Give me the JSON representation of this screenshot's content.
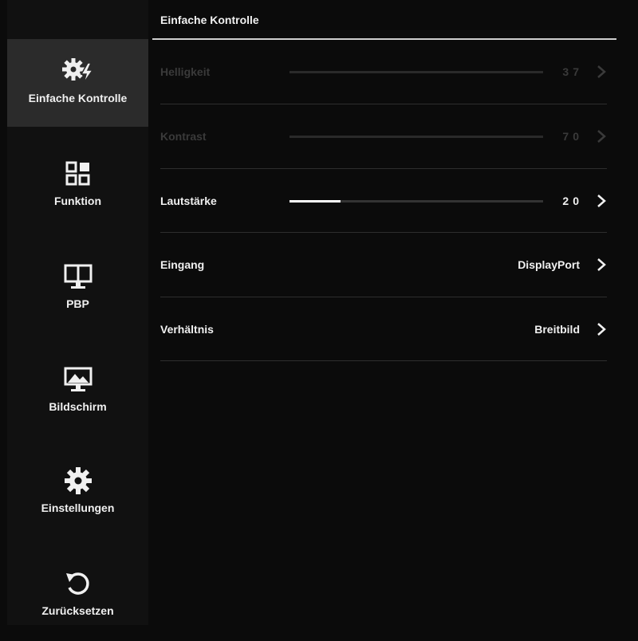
{
  "sidebar": {
    "items": [
      {
        "label": "Einfache Kontrolle",
        "icon": "gear-lightning-icon",
        "active": true
      },
      {
        "label": "Funktion",
        "icon": "grid-icon"
      },
      {
        "label": "PBP",
        "icon": "split-monitor-icon"
      },
      {
        "label": "Bildschirm",
        "icon": "monitor-image-icon"
      },
      {
        "label": "Einstellungen",
        "icon": "gear-icon"
      },
      {
        "label": "Zurücksetzen",
        "icon": "reset-icon"
      }
    ]
  },
  "main": {
    "title": "Einfache Kontrolle",
    "rows": [
      {
        "label": "Helligkeit",
        "value": "37",
        "level": 37,
        "disabled": true
      },
      {
        "label": "Kontrast",
        "value": "70",
        "level": 70,
        "disabled": true
      },
      {
        "label": "Lautstärke",
        "value": "20",
        "level": 20,
        "disabled": false
      },
      {
        "label": "Eingang",
        "value": "DisplayPort"
      },
      {
        "label": "Verhältnis",
        "value": "Breitbild"
      }
    ]
  },
  "colors": {
    "background": "#0b0b0b",
    "sidebar": "#111111",
    "active_item": "#2b2b2b",
    "text": "#f0f0f0",
    "disabled_text": "#3a3a3a",
    "slider_fill": "#ffffff"
  }
}
